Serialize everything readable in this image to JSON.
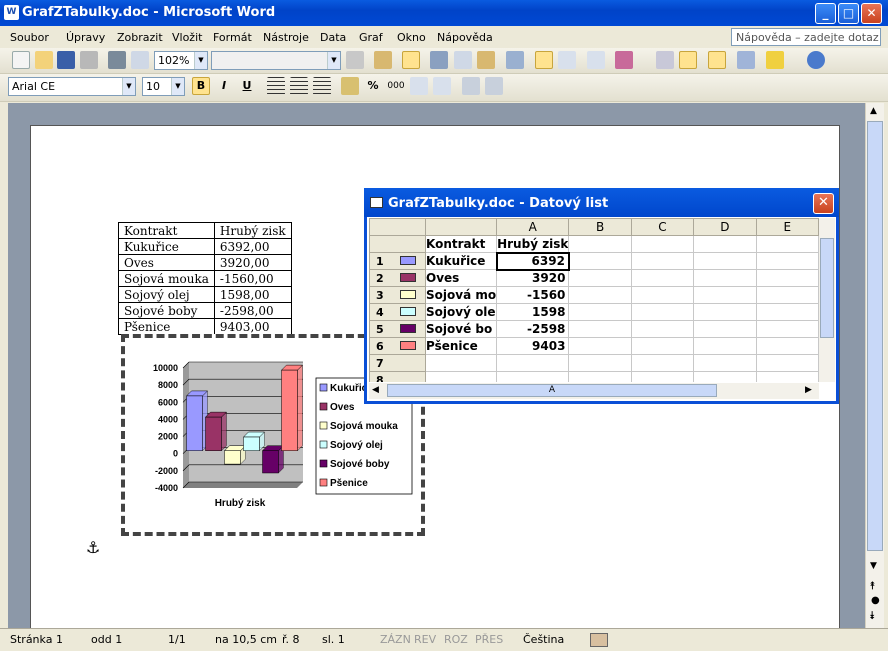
{
  "window": {
    "title": "GrafZTabulky.doc - Microsoft Word",
    "icon_label": "W"
  },
  "menu": [
    "Soubor",
    "Úpravy",
    "Zobrazit",
    "Vložit",
    "Formát",
    "Nástroje",
    "Data",
    "Graf",
    "Okno",
    "Nápověda"
  ],
  "help_placeholder": "Nápověda – zadejte dotaz",
  "toolbar": {
    "zoom": "102%",
    "font_name": "Arial CE",
    "font_size": "10",
    "bold_label": "B",
    "italic_label": "I",
    "underline_label": "U",
    "percent": "%",
    "thousands": "000"
  },
  "doc_table": {
    "headers": [
      "Kontrakt",
      "Hrubý zisk"
    ],
    "rows": [
      [
        "Kukuřice",
        "6392,00"
      ],
      [
        "Oves",
        "3920,00"
      ],
      [
        "Sojová mouka",
        "-1560,00"
      ],
      [
        "Sojový olej",
        "1598,00"
      ],
      [
        "Sojové boby",
        "-2598,00"
      ],
      [
        "Pšenice",
        "9403,00"
      ]
    ]
  },
  "chart_data": {
    "type": "bar",
    "xlabel": "Hrubý zisk",
    "ylim": [
      -4000,
      10000
    ],
    "yticks": [
      "10000",
      "8000",
      "6000",
      "4000",
      "2000",
      "0",
      "-2000",
      "-4000"
    ],
    "legend_position": "right",
    "series": [
      {
        "name": "Kukuřice",
        "values": [
          6392
        ],
        "color": "#9999ff"
      },
      {
        "name": "Oves",
        "values": [
          3920
        ],
        "color": "#993366"
      },
      {
        "name": "Sojová mouka",
        "values": [
          -1560
        ],
        "color": "#ffffcc"
      },
      {
        "name": "Sojový olej",
        "values": [
          1598
        ],
        "color": "#ccffff"
      },
      {
        "name": "Sojové boby",
        "values": [
          -2598
        ],
        "color": "#660066"
      },
      {
        "name": "Pšenice",
        "values": [
          9403
        ],
        "color": "#ff8080"
      }
    ]
  },
  "datasheet": {
    "title": "GrafZTabulky.doc - Datový list",
    "columns": [
      "A",
      "B",
      "C",
      "D",
      "E"
    ],
    "header_row": [
      "Kontrakt",
      "Hrubý zisk"
    ],
    "rows": [
      {
        "num": "1",
        "name": "Kukuřice",
        "value": "6392"
      },
      {
        "num": "2",
        "name": "Oves",
        "value": "3920"
      },
      {
        "num": "3",
        "name": "Sojová mo",
        "value": "-1560"
      },
      {
        "num": "4",
        "name": "Sojový ole",
        "value": "1598"
      },
      {
        "num": "5",
        "name": "Sojové bo",
        "value": "-2598"
      },
      {
        "num": "6",
        "name": "Pšenice",
        "value": "9403"
      },
      {
        "num": "7",
        "name": "",
        "value": ""
      },
      {
        "num": "8",
        "name": "",
        "value": ""
      }
    ],
    "hscroll_label": "A"
  },
  "status": {
    "page": "Stránka 1",
    "section": "odd 1",
    "pages": "1/1",
    "pos": "na 10,5 cm",
    "line": "ř. 8",
    "col": "sl. 1",
    "rec": "ZÁZN",
    "rev": "REV",
    "ext": "ROZ",
    "ovr": "PŘES",
    "lang": "Čeština"
  }
}
